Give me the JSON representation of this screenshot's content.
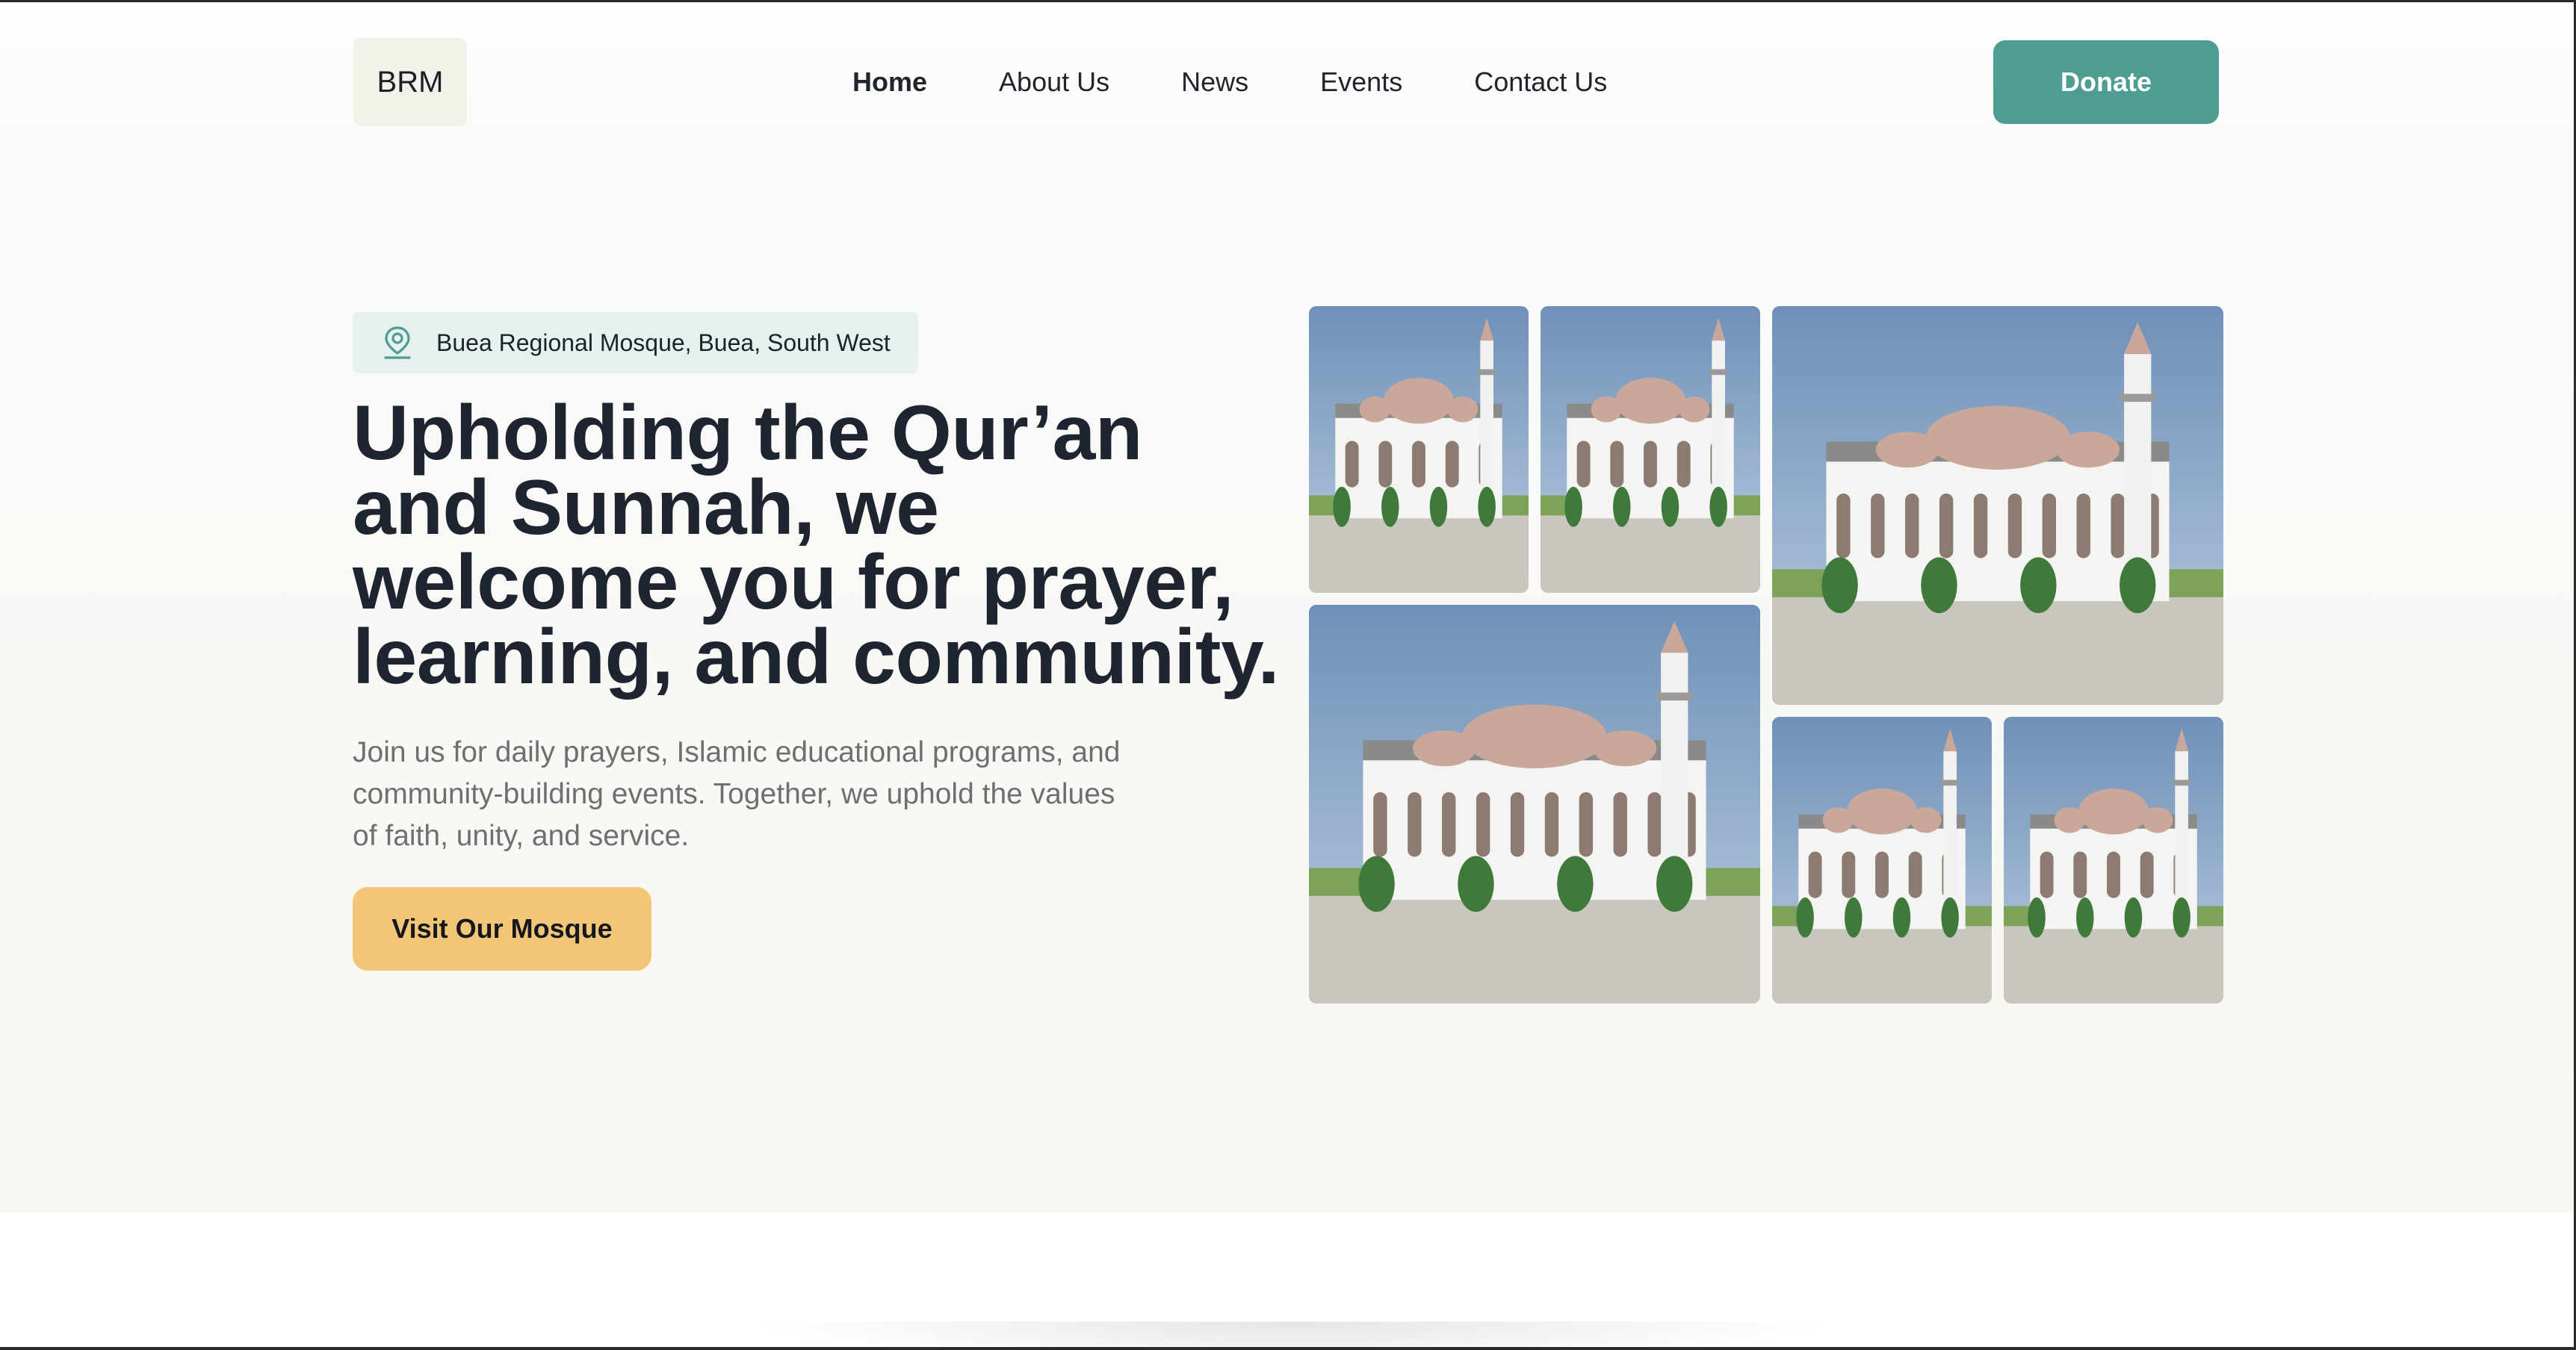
{
  "header": {
    "logo_text": "BRM",
    "nav": [
      {
        "label": "Home",
        "active": true
      },
      {
        "label": "About Us",
        "active": false
      },
      {
        "label": "News",
        "active": false
      },
      {
        "label": "Events",
        "active": false
      },
      {
        "label": "Contact Us",
        "active": false
      }
    ],
    "donate_label": "Donate"
  },
  "hero": {
    "location_icon": "map-pin-icon",
    "location": "Buea Regional Mosque, Buea, South West",
    "headline": "Upholding the Qur’an and Sunnah, we welcome you for prayer, learning, and community.",
    "description": "Join us for daily prayers, Islamic educational programs, and community-building events. Together, we uphold the values of faith, unity, and service.",
    "cta_label": "Visit Our Mosque"
  },
  "colors": {
    "accent": "#4e9d93",
    "cta": "#f3c677",
    "badge_bg": "#e6f0ee",
    "text_dark": "#1f2530"
  }
}
